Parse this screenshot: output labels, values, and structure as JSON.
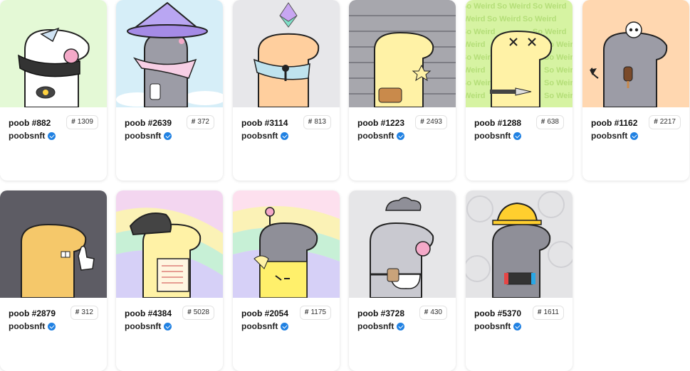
{
  "cards": [
    {
      "name": "poob #882",
      "rank": "1309",
      "creator": "poobsnft",
      "bg": "#e4f9d6"
    },
    {
      "name": "poob #2639",
      "rank": "372",
      "creator": "poobsnft",
      "bg": "#d6eef8"
    },
    {
      "name": "poob #3114",
      "rank": "813",
      "creator": "poobsnft",
      "bg": "#e7e7ea"
    },
    {
      "name": "poob #1223",
      "rank": "2493",
      "creator": "poobsnft",
      "bg": "#a7a7ad"
    },
    {
      "name": "poob #1288",
      "rank": "638",
      "creator": "poobsnft",
      "bg": "#d6f3a2",
      "pattern_text": "So Weird"
    },
    {
      "name": "poob #1162",
      "rank": "2217",
      "creator": "poobsnft",
      "bg": "#ffd7b0"
    },
    {
      "name": "poob #2879",
      "rank": "312",
      "creator": "poobsnft",
      "bg": "#5d5c64"
    },
    {
      "name": "poob #4384",
      "rank": "5028",
      "creator": "poobsnft",
      "bg": "#f3d6f0"
    },
    {
      "name": "poob #2054",
      "rank": "1175",
      "creator": "poobsnft",
      "bg": "#fde0ee"
    },
    {
      "name": "poob #3728",
      "rank": "430",
      "creator": "poobsnft",
      "bg": "#e6e6e8"
    },
    {
      "name": "poob #5370",
      "rank": "1611",
      "creator": "poobsnft",
      "bg": "#e4e4e6"
    }
  ],
  "rank_prefix": "#",
  "palette": {
    "verified": "#2081e2",
    "outline": "#222222"
  }
}
